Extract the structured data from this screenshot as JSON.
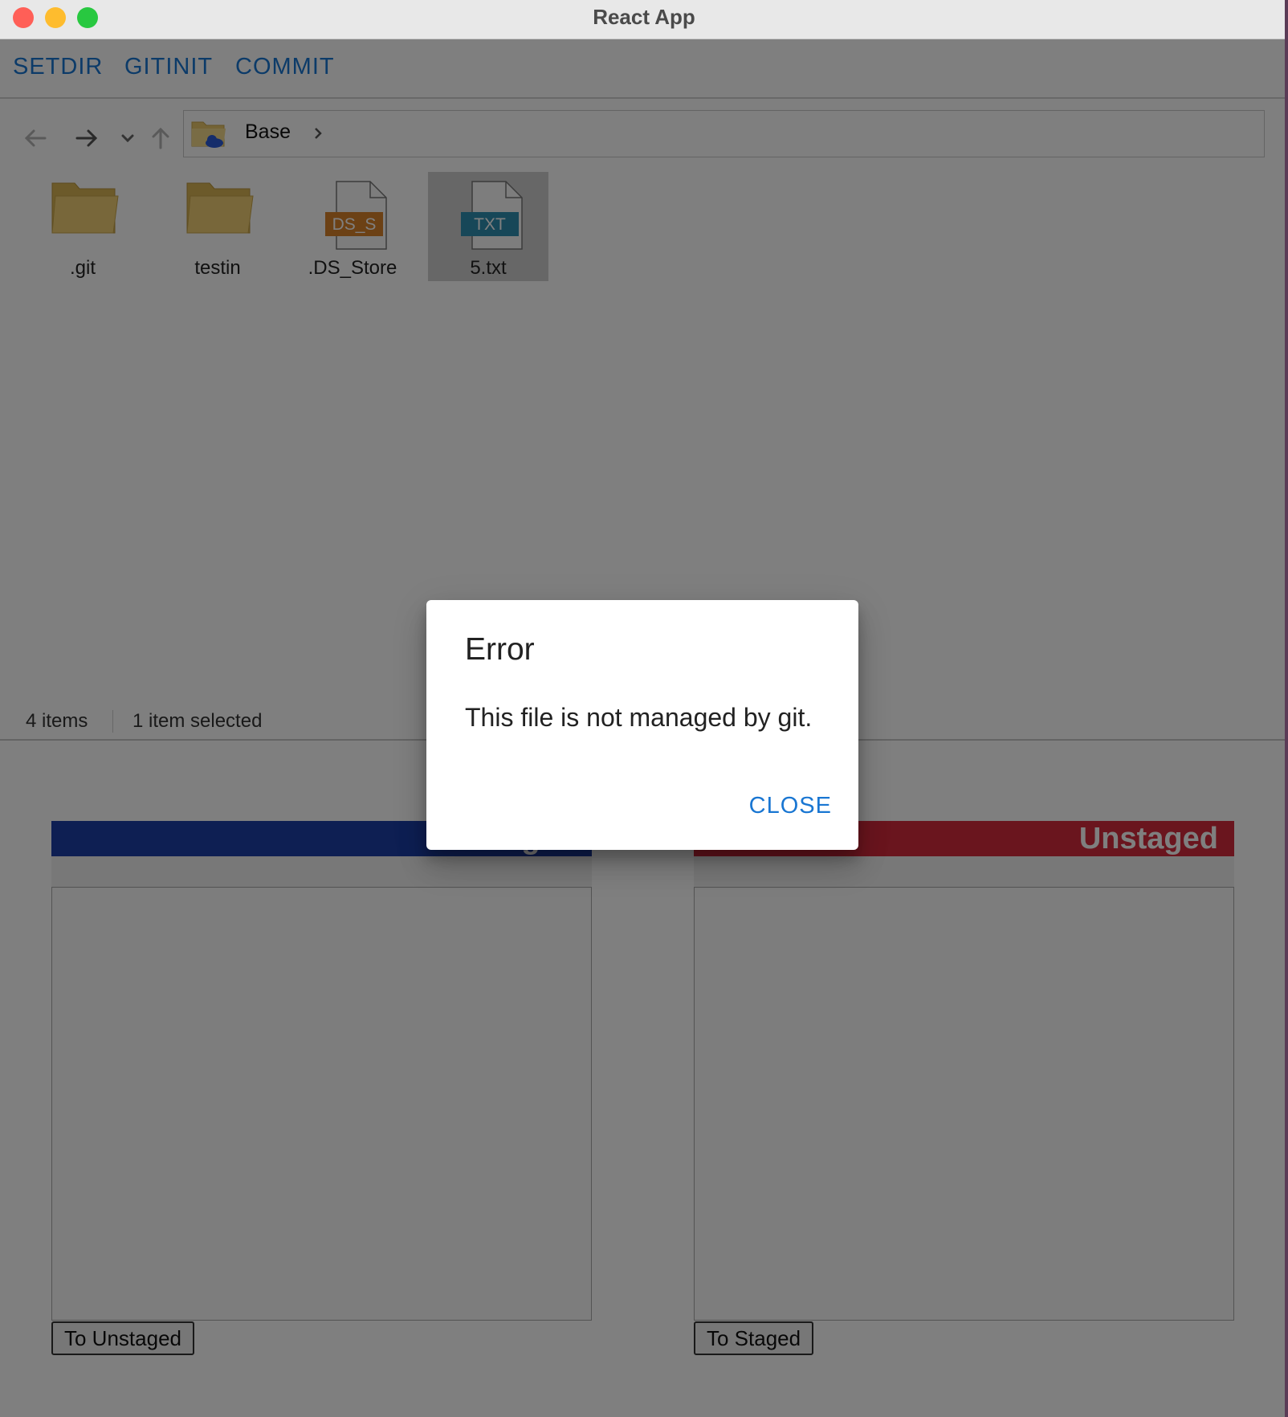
{
  "window": {
    "title": "React App"
  },
  "toolbar": {
    "setdir": "SETDIR",
    "gitinit": "GITINIT",
    "commit": "COMMIT"
  },
  "navigation": {
    "path": "Base"
  },
  "files": [
    {
      "name": ".git",
      "type": "folder"
    },
    {
      "name": "testin",
      "type": "folder"
    },
    {
      "name": ".DS_Store",
      "type": "file",
      "badge": "DS_S",
      "badge_color": "#d9822b"
    },
    {
      "name": "5.txt",
      "type": "file",
      "badge": "TXT",
      "badge_color": "#2e8fb0",
      "selected": true
    }
  ],
  "status": {
    "count": "4 items",
    "selected": "1 item selected"
  },
  "panels": {
    "staged": {
      "title": "Staged",
      "color": "#1d3fa6",
      "button": "To Unstaged"
    },
    "unstaged": {
      "title": "Unstaged",
      "color": "#d42a3c",
      "button": "To Staged"
    }
  },
  "dialog": {
    "title": "Error",
    "message": "This file is not managed by git.",
    "close": "CLOSE"
  },
  "colors": {
    "accent": "#1976d2"
  }
}
